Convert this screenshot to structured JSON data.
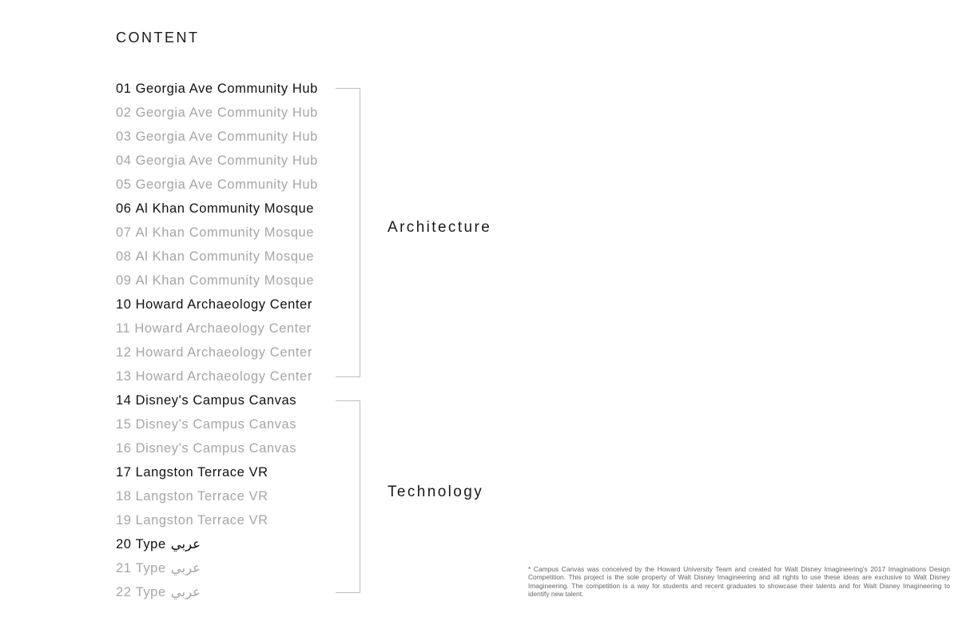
{
  "heading": "CONTENT",
  "items": [
    {
      "num": "01",
      "title": "Georgia Ave Community Hub",
      "state": "active"
    },
    {
      "num": "02",
      "title": "Georgia Ave Community Hub",
      "state": "muted"
    },
    {
      "num": "03",
      "title": "Georgia Ave Community Hub",
      "state": "muted"
    },
    {
      "num": "04",
      "title": "Georgia Ave Community Hub",
      "state": "muted"
    },
    {
      "num": "05",
      "title": "Georgia Ave Community Hub",
      "state": "muted"
    },
    {
      "num": "06",
      "title": "Al Khan Community Mosque",
      "state": "active"
    },
    {
      "num": "07",
      "title": "Al Khan Community Mosque",
      "state": "muted"
    },
    {
      "num": "08",
      "title": "Al Khan Community Mosque",
      "state": "muted"
    },
    {
      "num": "09",
      "title": "Al Khan Community Mosque",
      "state": "muted"
    },
    {
      "num": "10",
      "title": "Howard Archaeology Center",
      "state": "active"
    },
    {
      "num": "11",
      "title": "Howard Archaeology Center",
      "state": "muted"
    },
    {
      "num": "12",
      "title": "Howard Archaeology Center",
      "state": "muted"
    },
    {
      "num": "13",
      "title": "Howard Archaeology Center",
      "state": "muted"
    },
    {
      "num": "14",
      "title": "Disney's Campus Canvas",
      "state": "active"
    },
    {
      "num": "15",
      "title": "Disney's Campus Canvas",
      "state": "muted"
    },
    {
      "num": "16",
      "title": "Disney's Campus Canvas",
      "state": "muted"
    },
    {
      "num": "17",
      "title": "Langston Terrace VR",
      "state": "active"
    },
    {
      "num": "18",
      "title": "Langston Terrace VR",
      "state": "muted"
    },
    {
      "num": "19",
      "title": "Langston Terrace VR",
      "state": "muted"
    },
    {
      "num": "20",
      "title": "Type",
      "arabic": "عربي",
      "state": "active"
    },
    {
      "num": "21",
      "title": "Type",
      "arabic": "عربي",
      "state": "muted"
    },
    {
      "num": "22",
      "title": "Type",
      "arabic": "عربي",
      "state": "muted"
    }
  ],
  "sections": [
    {
      "label": "Architecture",
      "range": "01-13"
    },
    {
      "label": "Technology",
      "range": "14-22"
    }
  ],
  "footnote": "* Campus Canvas was conceived by the Howard University Team and created for Walt Disney Imagineering's 2017 Imaginations Design Competition. This project is the sole property of Walt Disney Imagineering and all rights to use these ideas are exclusive to Walt Disney Imagineering. The competition is a way for students and recent graduates to showcase their talents and for Walt Disney Imagineering to identify new talent.",
  "colors": {
    "active": "#111111",
    "muted": "#a6a6a6",
    "bracket": "#bdbdbd"
  }
}
